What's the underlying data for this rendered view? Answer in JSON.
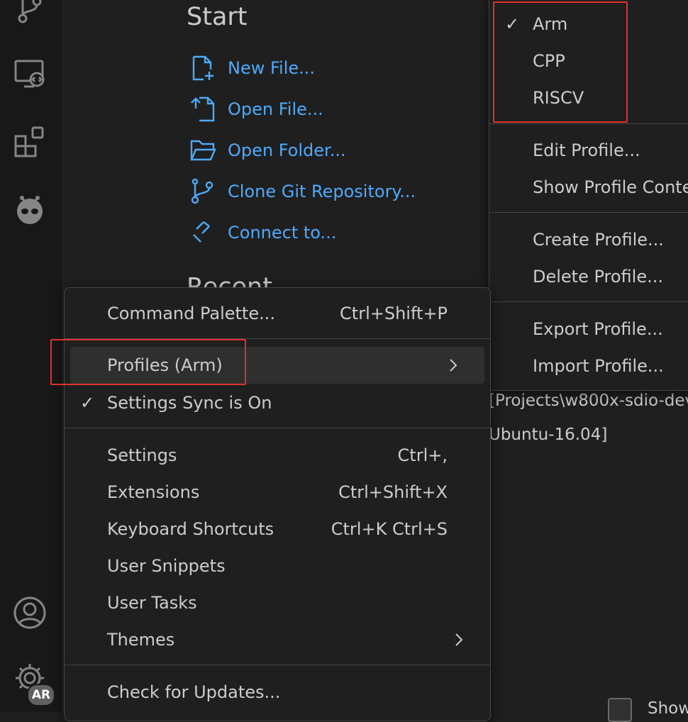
{
  "welcome": {
    "start_title": "Start",
    "actions": [
      {
        "label": "New File..."
      },
      {
        "label": "Open File..."
      },
      {
        "label": "Open Folder..."
      },
      {
        "label": "Clone Git Repository..."
      },
      {
        "label": "Connect to..."
      }
    ],
    "recent_title": "Recent",
    "recent_paths": [
      "[Projects\\w800x-sdio-dev",
      "Ubuntu-16.04]"
    ],
    "show_welcome_label": "Show"
  },
  "activity_bar": {
    "icons": [
      "source-control-icon",
      "remote-explorer-icon",
      "extensions-icon",
      "platformio-icon",
      "accounts-icon",
      "manage-gear-icon"
    ],
    "badge": "AR"
  },
  "manage_menu": {
    "items": [
      {
        "label": "Command Palette...",
        "shortcut": "Ctrl+Shift+P"
      },
      {
        "label": "Profiles (Arm)"
      },
      {
        "label": "Settings Sync is On",
        "checked": "✓"
      },
      {
        "label": "Settings",
        "shortcut": "Ctrl+,"
      },
      {
        "label": "Extensions",
        "shortcut": "Ctrl+Shift+X"
      },
      {
        "label": "Keyboard Shortcuts",
        "shortcut": "Ctrl+K Ctrl+S"
      },
      {
        "label": "User Snippets"
      },
      {
        "label": "User Tasks"
      },
      {
        "label": "Themes"
      },
      {
        "label": "Check for Updates..."
      }
    ]
  },
  "profiles_submenu": {
    "items": [
      {
        "label": "Arm",
        "checked": "✓"
      },
      {
        "label": "CPP"
      },
      {
        "label": "RISCV"
      },
      {
        "label": "Edit Profile..."
      },
      {
        "label": "Show Profile Contents"
      },
      {
        "label": "Create Profile..."
      },
      {
        "label": "Delete Profile..."
      },
      {
        "label": "Export Profile..."
      },
      {
        "label": "Import Profile..."
      }
    ]
  },
  "colors": {
    "link": "#4daafc",
    "background": "#1f1f1f",
    "annotation": "#e03030"
  }
}
